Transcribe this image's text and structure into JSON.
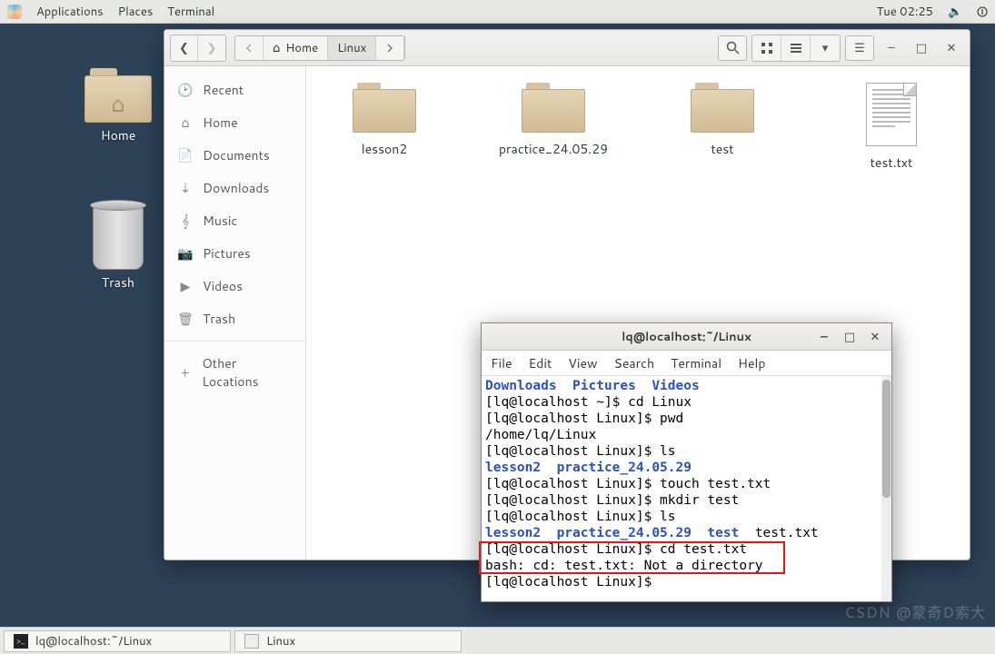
{
  "topbar": {
    "menu": [
      "Applications",
      "Places",
      "Terminal"
    ],
    "clock": "Tue 02:25"
  },
  "desktop": {
    "home_label": "Home",
    "trash_label": "Trash"
  },
  "filewin": {
    "path": {
      "home": "Home",
      "current": "Linux"
    },
    "sidebar": {
      "recent": "Recent",
      "home": "Home",
      "documents": "Documents",
      "downloads": "Downloads",
      "music": "Music",
      "pictures": "Pictures",
      "videos": "Videos",
      "trash": "Trash",
      "other": "Other Locations"
    },
    "items": [
      "lesson2",
      "practice_24.05.29",
      "test",
      "test.txt"
    ]
  },
  "terminal": {
    "title": "lq@localhost:~/Linux",
    "menu": [
      "File",
      "Edit",
      "View",
      "Search",
      "Terminal",
      "Help"
    ],
    "lines": [
      {
        "t": "Downloads  Pictures  Videos",
        "c": "blue"
      },
      {
        "t": "[lq@localhost ~]$ cd Linux"
      },
      {
        "t": "[lq@localhost Linux]$ pwd"
      },
      {
        "t": "/home/lq/Linux"
      },
      {
        "t": "[lq@localhost Linux]$ ls"
      },
      {
        "t": "lesson2  practice_24.05.29",
        "c": "blue"
      },
      {
        "t": "[lq@localhost Linux]$ touch test.txt"
      },
      {
        "t": "[lq@localhost Linux]$ mkdir test"
      },
      {
        "t": "[lq@localhost Linux]$ ls"
      },
      {
        "segs": [
          {
            "t": "lesson2  practice_24.05.29  test",
            "c": "blue"
          },
          {
            "t": "  test.txt"
          }
        ]
      },
      {
        "t": "[lq@localhost Linux]$ cd test.txt"
      },
      {
        "t": "bash: cd: test.txt: Not a directory"
      },
      {
        "t": "[lq@localhost Linux]$ "
      }
    ]
  },
  "taskbar": {
    "task1": "lq@localhost:~/Linux",
    "task2": "Linux"
  },
  "watermark": "CSDN @蒙奇D索大"
}
